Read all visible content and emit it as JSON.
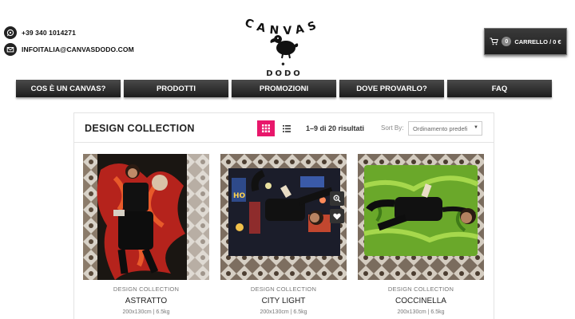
{
  "header": {
    "phone": "+39 340 1014271",
    "email": "INFOITALIA@CANVASDODO.COM",
    "logo_top": "CANVAS",
    "logo_bottom": "DODO",
    "logo_bottom_display": "• DODO •"
  },
  "cart": {
    "count": "0",
    "label": "CARRELLO / 0 €"
  },
  "nav": {
    "items": [
      "COS È UN CANVAS?",
      "PRODOTTI",
      "PROMOZIONI",
      "DOVE PROVARLO?",
      "FAQ"
    ]
  },
  "main": {
    "title": "DESIGN COLLECTION",
    "results": "1–9 di 20 risultati",
    "sort_label": "Sort By:",
    "sort_value": "Ordinamento predefi",
    "accent": "#e8176b",
    "products": [
      {
        "category": "DESIGN COLLECTION",
        "name": "ASTRATTO",
        "dims": "200x130cm | 6.5kg"
      },
      {
        "category": "DESIGN COLLECTION",
        "name": "CITY LIGHT",
        "dims": "200x130cm | 6.5kg"
      },
      {
        "category": "DESIGN COLLECTION",
        "name": "COCCINELLA",
        "dims": "200x130cm | 6.5kg"
      }
    ]
  }
}
